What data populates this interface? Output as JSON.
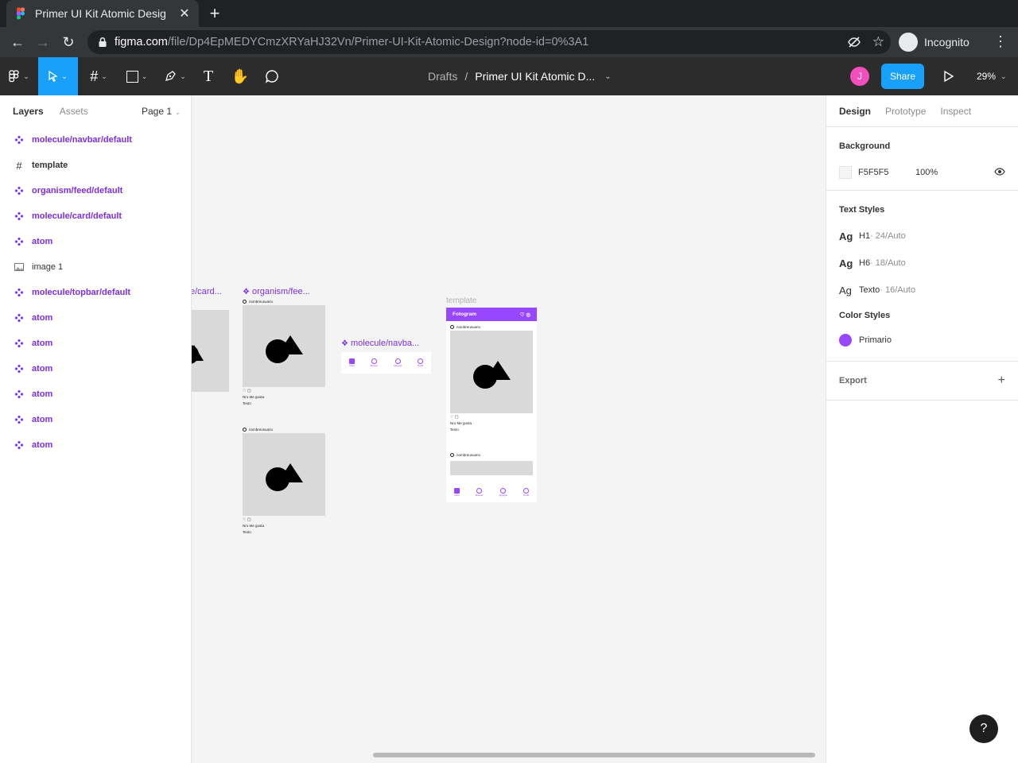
{
  "browser": {
    "tab_title": "Primer UI Kit Atomic Desig",
    "url_host": "figma.com",
    "url_path": "/file/Dp4EpMEDYCmzXRYaHJ32Vn/Primer-UI-Kit-Atomic-Design?node-id=0%3A1",
    "incognito_label": "Incognito"
  },
  "toolbar": {
    "breadcrumb_drafts": "Drafts",
    "breadcrumb_sep": "/",
    "file_name": "Primer UI Kit Atomic D...",
    "avatar_initial": "J",
    "share_label": "Share",
    "zoom": "29%"
  },
  "left_panel": {
    "tab_layers": "Layers",
    "tab_assets": "Assets",
    "page": "Page 1",
    "layers": [
      {
        "label": "molecule/navbar/default",
        "kind": "component"
      },
      {
        "label": "template",
        "kind": "frame"
      },
      {
        "label": "organism/feed/default",
        "kind": "component"
      },
      {
        "label": "molecule/card/default",
        "kind": "component"
      },
      {
        "label": "atom",
        "kind": "component"
      },
      {
        "label": "image 1",
        "kind": "image"
      },
      {
        "label": "molecule/topbar/default",
        "kind": "component"
      },
      {
        "label": "atom",
        "kind": "component"
      },
      {
        "label": "atom",
        "kind": "component"
      },
      {
        "label": "atom",
        "kind": "component"
      },
      {
        "label": "atom",
        "kind": "component"
      },
      {
        "label": "atom",
        "kind": "component"
      },
      {
        "label": "atom",
        "kind": "component"
      }
    ]
  },
  "canvas": {
    "label_card": "e/card...",
    "label_feed": "organism/fee...",
    "label_navbar": "molecule/navba...",
    "label_template": "template",
    "username": "nombreusuario",
    "likes": "Nro Me gusta",
    "texto": "Texto",
    "app_title": "Fotogram",
    "nav_items": [
      "Inicio",
      "Buscar",
      "Agregar",
      "Perfil"
    ]
  },
  "right_panel": {
    "tab_design": "Design",
    "tab_prototype": "Prototype",
    "tab_inspect": "Inspect",
    "background_title": "Background",
    "bg_hex": "F5F5F5",
    "bg_opacity": "100%",
    "text_styles_title": "Text Styles",
    "text_styles": [
      {
        "ag": "Ag",
        "name": "H1",
        "meta": " · 24/Auto",
        "weight": "bold"
      },
      {
        "ag": "Ag",
        "name": "H6",
        "meta": " · 18/Auto",
        "weight": "bold"
      },
      {
        "ag": "Ag",
        "name": "Texto",
        "meta": " · 16/Auto",
        "weight": "normal"
      }
    ],
    "color_styles_title": "Color Styles",
    "color_style_name": "Primario",
    "color_style_hex": "#9747FF",
    "export_title": "Export",
    "export_plus": "+"
  },
  "help": "?",
  "colors": {
    "accent": "#18a0fb",
    "primary": "#9747ff",
    "component": "#7b2ee5"
  }
}
